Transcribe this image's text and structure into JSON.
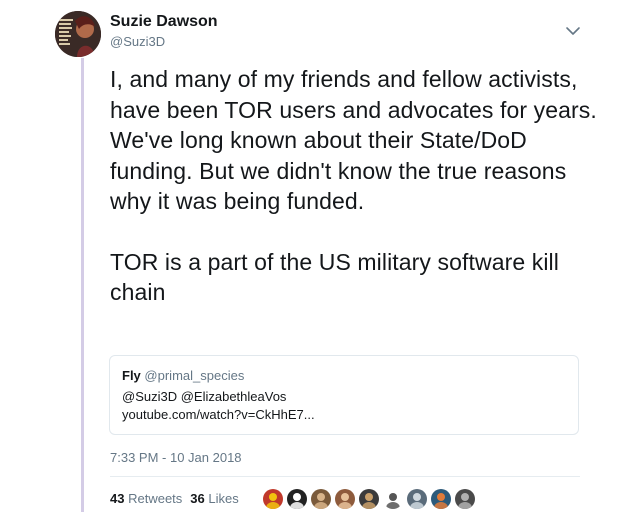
{
  "tweet": {
    "author": {
      "display_name": "Suzie Dawson",
      "handle": "@Suzi3D",
      "avatar_icon": "profile-photo"
    },
    "menu_icon": "chevron-down-icon",
    "text_paragraphs": [
      "I, and many of my friends and fellow activists, have been TOR users and advocates for years. We've long known about their State/DoD funding. But we didn't know the true reasons why it was being funded.",
      "TOR is a part of the US military software kill chain"
    ],
    "quoted": {
      "name": "Fly",
      "handle": "@primal_species",
      "mentions": "@Suzi3D @ElizabethleaVos",
      "link": "youtube.com/watch?v=CkHhE7..."
    },
    "timestamp": "7:33 PM - 10 Jan 2018",
    "stats": {
      "retweets_count": "43",
      "retweets_label": "Retweets",
      "likes_count": "36",
      "likes_label": "Likes"
    },
    "likers": [
      {
        "color": "#c0392b",
        "accent": "#f1c40f"
      },
      {
        "color": "#222222",
        "accent": "#ffffff"
      },
      {
        "color": "#7a5a3a",
        "accent": "#d8b48a"
      },
      {
        "color": "#8e5b3c",
        "accent": "#e7c29a"
      },
      {
        "color": "#3b3b3b",
        "accent": "#c9a06b"
      },
      {
        "color": "#ffffff",
        "accent": "#555555"
      },
      {
        "color": "#5a6b7a",
        "accent": "#cfd8df"
      },
      {
        "color": "#2c5a7a",
        "accent": "#e07b39"
      },
      {
        "color": "#4a4a4a",
        "accent": "#b0b0b0"
      }
    ]
  },
  "colors": {
    "text": "#14171a",
    "secondary": "#657786",
    "border": "#e1e8ed",
    "thread_line": "#d4cce6"
  }
}
